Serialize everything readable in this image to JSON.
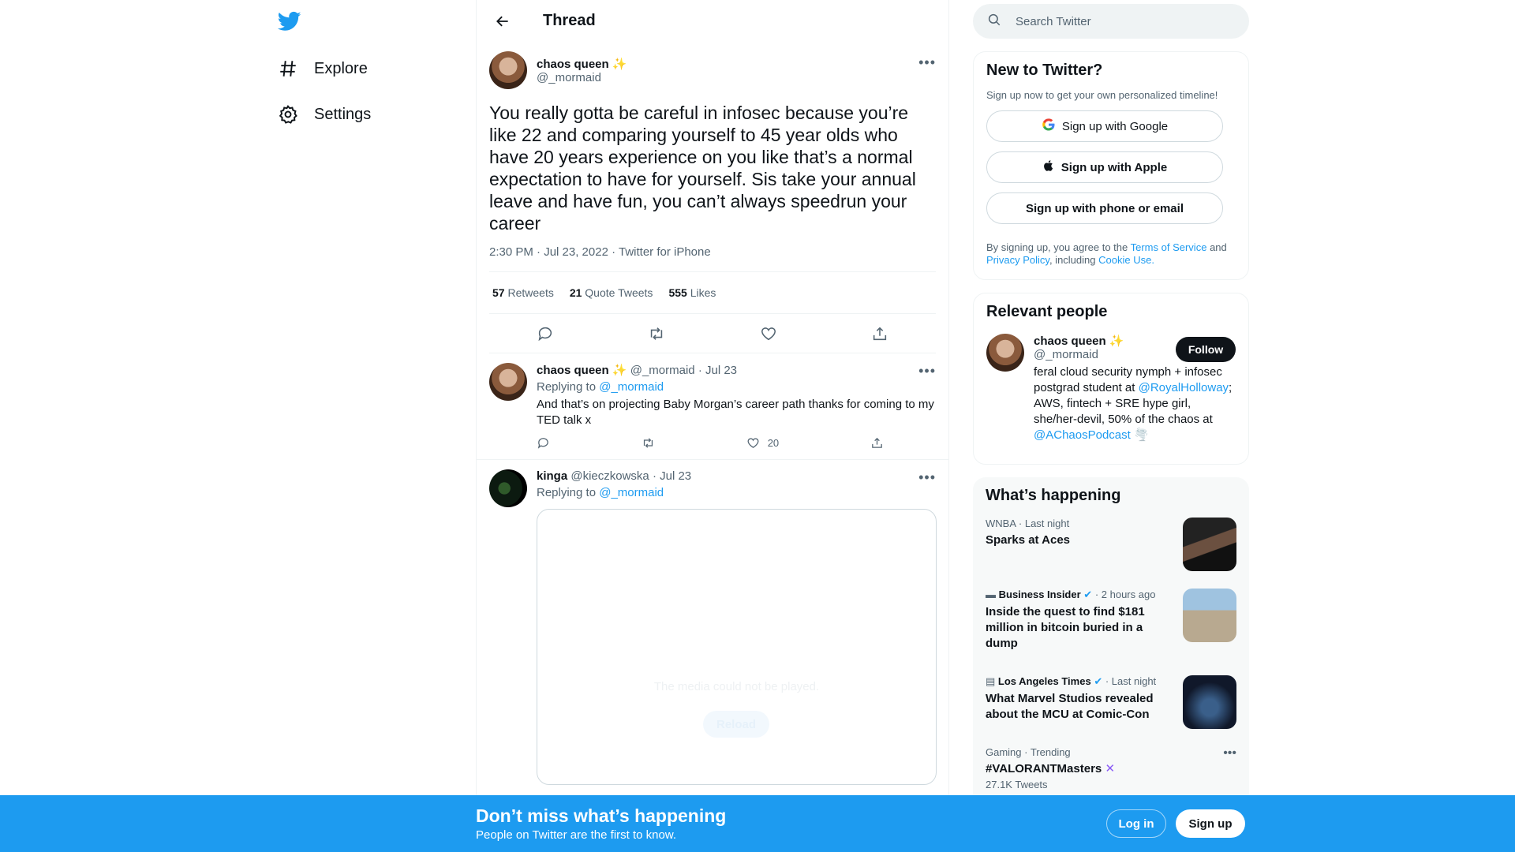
{
  "nav": {
    "explore": "Explore",
    "settings": "Settings"
  },
  "header": {
    "title": "Thread"
  },
  "tweet": {
    "name": "chaos queen",
    "emoji": "✨",
    "handle": "@_mormaid",
    "text": "You really gotta be careful in infosec because you’re like 22 and comparing yourself to 45 year olds who have 20 years experience on you like that’s a normal expectation to have for yourself. Sis take your annual leave and have fun, you can’t always speedrun your career",
    "meta": "2:30 PM · Jul 23, 2022 · Twitter for iPhone",
    "retweets_count": "57",
    "retweets_label": "Retweets",
    "quotes_count": "21",
    "quotes_label": "Quote Tweets",
    "likes_count": "555",
    "likes_label": "Likes"
  },
  "replies": [
    {
      "name": "chaos queen",
      "emoji": "✨",
      "handle": "@_mormaid",
      "date": "· Jul 23",
      "replying_label": "Replying to",
      "replying_to": "@_mormaid",
      "text": "And that’s on projecting Baby Morgan’s career path thanks for coming to my TED talk x",
      "likes": "20"
    },
    {
      "name": "kinga",
      "handle": "@kieczkowska",
      "date": "· Jul 23",
      "replying_label": "Replying to",
      "replying_to": "@_mormaid",
      "media_msg": "The media could not be played.",
      "media_reload": "Reload"
    }
  ],
  "search": {
    "placeholder": "Search Twitter"
  },
  "new_to_twitter": {
    "title": "New to Twitter?",
    "subtitle": "Sign up now to get your own personalized timeline!",
    "google": "Sign up with Google",
    "apple": "Sign up with Apple",
    "phone": "Sign up with phone or email",
    "terms_pre": "By signing up, you agree to the",
    "terms_link": "Terms of Service",
    "terms_and": "and",
    "privacy_link": "Privacy Policy",
    "terms_including": ", including",
    "cookie_link": "Cookie Use."
  },
  "relevant": {
    "title": "Relevant people",
    "name": "chaos queen",
    "emoji": "✨",
    "handle": "@_mormaid",
    "follow": "Follow",
    "bio_1": "feral cloud security nymph + infosec postgrad student at",
    "bio_link1": "@RoyalHolloway",
    "bio_2": "; AWS, fintech + SRE hype girl, she/her-devil, 50% of the chaos at",
    "bio_link2": "@AChaosPodcast",
    "bio_emoji": "🌪️"
  },
  "happening": {
    "title": "What’s happening",
    "items": [
      {
        "cat": "WNBA · Last night",
        "title": "Sparks at Aces"
      },
      {
        "source": "Business Insider",
        "time": "· 2 hours ago",
        "title": "Inside the quest to find $181 million in bitcoin buried in a dump"
      },
      {
        "source": "Los Angeles Times",
        "time": "· Last night",
        "title": "What Marvel Studios revealed about the MCU at Comic-Con"
      },
      {
        "cat": "Gaming · Trending",
        "title": "#VALORANTMasters",
        "count": "27.1K Tweets"
      }
    ]
  },
  "bottom": {
    "title": "Don’t miss what’s happening",
    "subtitle": "People on Twitter are the first to know.",
    "login": "Log in",
    "signup": "Sign up"
  }
}
